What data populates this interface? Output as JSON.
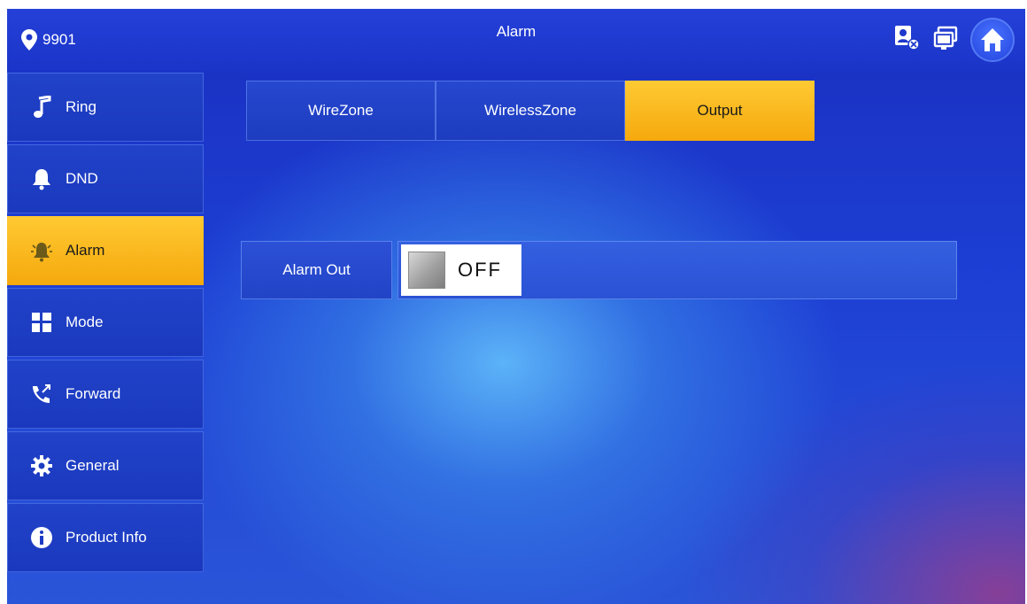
{
  "header": {
    "location": "9901",
    "title": "Alarm",
    "icons": [
      "location-pin-icon",
      "contact-status-icon",
      "monitor-status-icon",
      "home-icon"
    ]
  },
  "sidebar": {
    "items": [
      {
        "label": "Ring",
        "icon": "music-note-icon",
        "active": false
      },
      {
        "label": "DND",
        "icon": "bell-icon",
        "active": false
      },
      {
        "label": "Alarm",
        "icon": "alarm-bell-icon",
        "active": true
      },
      {
        "label": "Mode",
        "icon": "mode-grid-icon",
        "active": false
      },
      {
        "label": "Forward",
        "icon": "call-forward-icon",
        "active": false
      },
      {
        "label": "General",
        "icon": "gear-icon",
        "active": false
      },
      {
        "label": "Product Info",
        "icon": "info-icon",
        "active": false
      }
    ]
  },
  "tabs": [
    {
      "label": "WireZone",
      "active": false
    },
    {
      "label": "WirelessZone",
      "active": false
    },
    {
      "label": "Output",
      "active": true
    }
  ],
  "settings": {
    "alarm_out": {
      "label": "Alarm Out",
      "state": "OFF"
    }
  },
  "colors": {
    "accent": "#f5b21a",
    "background": "#1d3fd4",
    "text": "#ffffff"
  }
}
